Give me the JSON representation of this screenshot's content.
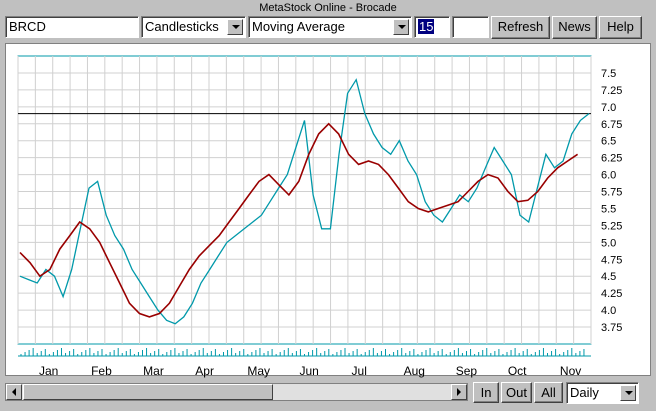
{
  "window_title": "MetaStock Online - Brocade",
  "toolbar": {
    "symbol": "BRCD",
    "chart_type": "Candlesticks",
    "indicator": "Moving Average",
    "period": "15",
    "refresh_label": "Refresh",
    "news_label": "News",
    "help_label": "Help"
  },
  "footer": {
    "in_label": "In",
    "out_label": "Out",
    "all_label": "All",
    "interval": "Daily"
  },
  "colors": {
    "price": "#0099aa",
    "moving_average": "#990000",
    "reference_line": "#000000",
    "grid": "#d0d0d0"
  },
  "chart_data": {
    "type": "line",
    "x_axis": "months",
    "months": [
      "Jan",
      "Feb",
      "Mar",
      "Apr",
      "May",
      "Jun",
      "Jul",
      "Aug",
      "Sep",
      "Oct",
      "Nov"
    ],
    "y_ticks": [
      "7.5",
      "7.25",
      "7.0",
      "6.75",
      "6.5",
      "6.25",
      "6.0",
      "5.75",
      "5.5",
      "5.25",
      "5.0",
      "4.75",
      "4.5",
      "4.25",
      "4.0",
      "3.75"
    ],
    "ylim": [
      3.5,
      7.75
    ],
    "reference_level": 6.9,
    "series": [
      {
        "values": [
          4.5,
          4.45,
          4.4,
          4.6,
          4.5,
          4.2,
          4.6,
          5.2,
          5.8,
          5.9,
          5.4,
          5.1,
          4.9,
          4.6,
          4.4,
          4.2,
          4.0,
          3.85,
          3.8,
          3.9,
          4.1,
          4.4,
          4.6,
          4.8,
          5.0,
          5.1,
          5.2,
          5.3,
          5.4,
          5.6,
          5.8,
          6.0,
          6.4,
          6.8,
          5.7,
          5.2,
          5.2,
          6.3,
          7.2,
          7.4,
          6.9,
          6.6,
          6.4,
          6.3,
          6.5,
          6.2,
          6.0,
          5.6,
          5.4,
          5.3,
          5.5,
          5.7,
          5.6,
          5.8,
          6.1,
          6.4,
          6.2,
          6.0,
          5.4,
          5.3,
          5.8,
          6.3,
          6.1,
          6.2,
          6.6,
          6.8,
          6.9
        ]
      },
      {
        "values": [
          4.85,
          4.7,
          4.5,
          4.6,
          4.9,
          5.1,
          5.3,
          5.2,
          5.0,
          4.7,
          4.4,
          4.1,
          3.95,
          3.9,
          3.95,
          4.1,
          4.35,
          4.6,
          4.8,
          4.95,
          5.1,
          5.3,
          5.5,
          5.7,
          5.9,
          6.0,
          5.85,
          5.7,
          5.9,
          6.3,
          6.6,
          6.75,
          6.6,
          6.3,
          6.15,
          6.2,
          6.15,
          6.0,
          5.8,
          5.6,
          5.5,
          5.45,
          5.5,
          5.55,
          5.6,
          5.75,
          5.9,
          6.0,
          5.95,
          5.75,
          5.6,
          5.62,
          5.75,
          5.95,
          6.1,
          6.2,
          6.3
        ]
      }
    ]
  }
}
